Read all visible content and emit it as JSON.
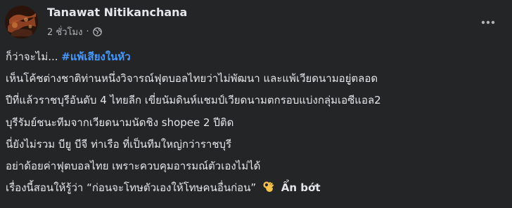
{
  "post": {
    "author": "Tanawat Nitikanchana",
    "timestamp": "2 ชั่วโมง",
    "timestamp_display": "2 ชั่วโมง",
    "audience_icon": "globe-icon",
    "more_icon": "more-horizontal-icon",
    "intro_text": "ก็ว่าจะไม่...",
    "hashtag": "#แพ้เสียงในหัว",
    "lines": [
      "เห็นโค้ชต่างชาติท่านหนึ่งวิจารณ์ฟุตบอลไทยว่าไม่พัฒนา และแพ้เวียดนามอยู่ตลอด",
      "ปีที่แล้วราชบุรีอันดับ 4 ไทยลีก เขี่ยนัมดินห์แชมป์เวียดนามตกรอบแบ่งกลุ่มเอซีแอล2",
      "บุรีรัมย์ชนะทีมจากเวียดนามนัดชิง shopee 2 ปีติด",
      "นี่ยังไม่รวม บียู บีจี ท่าเรือ ที่เป็นทีมใหญ่กว่าราชบุรี",
      "อย่าด้อยค่าฟุตบอลไทย เพราะควบคุมอารมณ์ตัวเองไม่ได้"
    ],
    "last_line": "เรื่องนี้สอนให้รู้ว่า “ก่อนจะโทษตัวเองให้โทษคนอื่นก่อน”",
    "emoji_icon": "ok-hand-emoji-icon",
    "see_less_label": "Ẩn bớt"
  }
}
